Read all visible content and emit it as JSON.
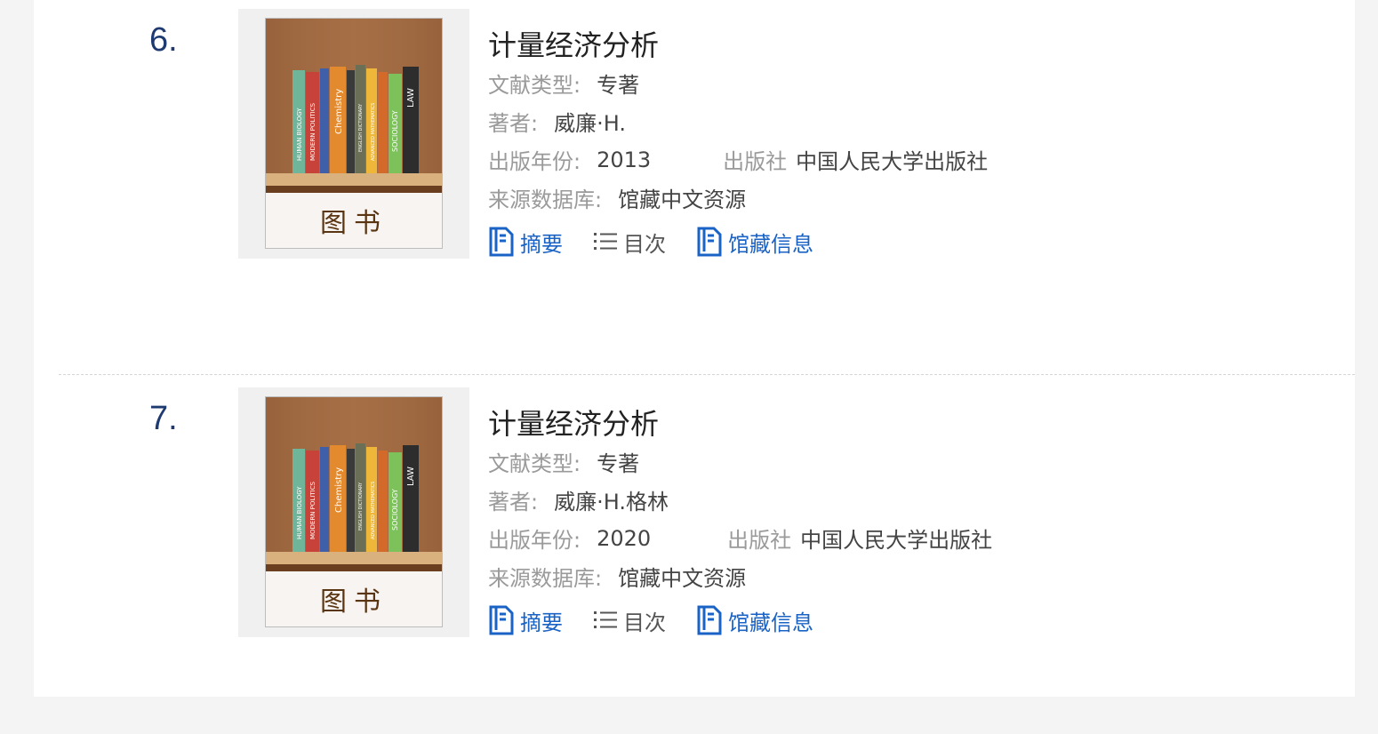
{
  "cover_text": "图书",
  "spine_titles": [
    "HUMAN BIOLOGY",
    "MODERN POLITICS",
    "Chemistry",
    "",
    "ENGLISH DICTIONARY",
    "ADVANCED MATHEMATICS",
    "SOCIOLOGY",
    "LAW"
  ],
  "colors": {
    "accent": "#1a63c6",
    "number": "#1f3a70"
  },
  "results": [
    {
      "index": "6.",
      "title": "计量经济分析",
      "type_label": "文献类型:",
      "type_value": "专著",
      "author_label": "著者:",
      "author_value": "威廉·H.",
      "year_label": "出版年份:",
      "year_value": "2013",
      "publisher_label": "出版社",
      "publisher_value": "中国人民大学出版社",
      "source_label": "来源数据库:",
      "source_value": "馆藏中文资源",
      "actions": {
        "abstract": "摘要",
        "toc": "目次",
        "holdings": "馆藏信息"
      }
    },
    {
      "index": "7.",
      "title": "计量经济分析",
      "type_label": "文献类型:",
      "type_value": "专著",
      "author_label": "著者:",
      "author_value": "威廉·H.格林",
      "year_label": "出版年份:",
      "year_value": "2020",
      "publisher_label": "出版社",
      "publisher_value": "中国人民大学出版社",
      "source_label": "来源数据库:",
      "source_value": "馆藏中文资源",
      "actions": {
        "abstract": "摘要",
        "toc": "目次",
        "holdings": "馆藏信息"
      }
    }
  ]
}
